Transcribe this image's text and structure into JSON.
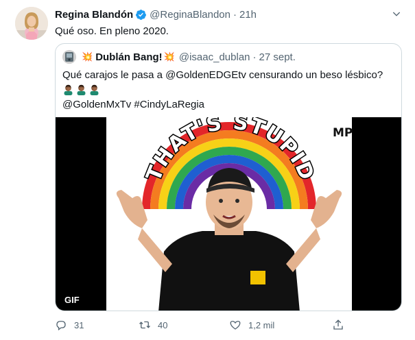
{
  "tweet": {
    "author_name": "Regina Blandón",
    "author_handle": "@ReginaBlandon",
    "separator": "·",
    "time": "21h",
    "text": "Qué oso. En pleno 2020.",
    "quoted": {
      "boom_left": "💥",
      "author_name": "Dublán Bang!",
      "boom_right": "💥",
      "author_handle": "@isaac_dublan",
      "separator": "·",
      "time": "27 sept.",
      "line1": "Qué carajos le pasa a @GoldenEDGEtv censurando un beso lésbico?",
      "line3": "@GoldenMxTv #CindyLaRegia",
      "emoji_count": 3,
      "media": {
        "badge": "GIF",
        "caption": "THAT'S STUPID",
        "logo": "MP",
        "rainbow_colors": [
          "#e3262a",
          "#f47c20",
          "#f7d117",
          "#2fa84f",
          "#1f5fd1",
          "#6a2ca5"
        ]
      }
    },
    "actions": {
      "reply_count": "31",
      "retweet_count": "40",
      "like_count": "1,2 mil"
    },
    "colors": {
      "verified": "#1d9bf0",
      "secondary_text": "#536471",
      "border": "#cfd9de"
    }
  }
}
